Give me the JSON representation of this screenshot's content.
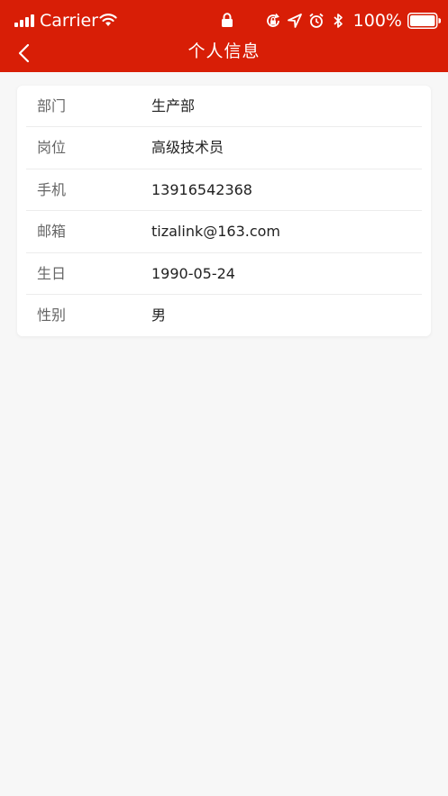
{
  "status_bar": {
    "carrier": "Carrier",
    "battery_percent": "100%",
    "icons": [
      "signal-icon",
      "wifi-icon",
      "lock-icon",
      "orientation-lock-icon",
      "location-icon",
      "alarm-icon",
      "bluetooth-icon",
      "battery-icon"
    ]
  },
  "nav": {
    "title": "个人信息",
    "back_icon": "chevron-left-icon"
  },
  "profile": {
    "rows": [
      {
        "label": "部门",
        "value": "生产部"
      },
      {
        "label": "岗位",
        "value": "高级技术员"
      },
      {
        "label": "手机",
        "value": "13916542368"
      },
      {
        "label": "邮箱",
        "value": "tizalink@163.com"
      },
      {
        "label": "生日",
        "value": "1990-05-24"
      },
      {
        "label": "性别",
        "value": "男"
      }
    ]
  },
  "colors": {
    "header_bg": "#d81e06",
    "page_bg": "#f7f7f7",
    "card_bg": "#ffffff"
  }
}
